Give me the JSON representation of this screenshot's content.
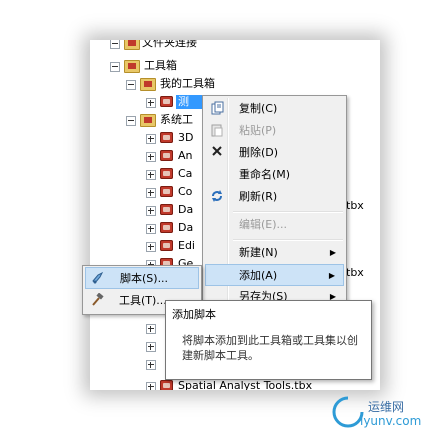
{
  "tree": {
    "top_cut": "文件夹连接",
    "toolbox_root": "工具箱",
    "my_toolbox": "我的工具箱",
    "selected_item": "测",
    "system_toolbox": "系统工",
    "children": [
      "3D",
      "An",
      "Ca",
      "Co",
      "Da",
      "Da",
      "Edi",
      "Ge"
    ],
    "bottom_cut": "Spatial Analyst Tools.tbx",
    "right_fragment_1": "tbx",
    "right_fragment_2": "tbx"
  },
  "context_menu": {
    "items": [
      {
        "label": "复制(C)",
        "icon": "copy-icon",
        "disabled": false
      },
      {
        "label": "粘贴(P)",
        "icon": "paste-icon",
        "disabled": true
      },
      {
        "label": "删除(D)",
        "icon": "delete-icon",
        "disabled": false
      },
      {
        "label": "重命名(M)",
        "icon": "",
        "disabled": false
      },
      {
        "label": "刷新(R)",
        "icon": "refresh-icon",
        "disabled": false
      },
      {
        "label": "编辑(E)...",
        "icon": "",
        "disabled": true
      },
      {
        "label": "新建(N)",
        "icon": "",
        "disabled": false,
        "submenu": true
      },
      {
        "label": "添加(A)",
        "icon": "",
        "disabled": false,
        "submenu": true,
        "highlighted": true
      },
      {
        "label": "另存为(S)",
        "icon": "",
        "disabled": false,
        "submenu": true
      }
    ]
  },
  "submenu": {
    "items": [
      {
        "label": "脚本(S)...",
        "icon": "script-icon"
      },
      {
        "label": "工具(T)...",
        "icon": "hammer-icon"
      }
    ]
  },
  "tooltip": {
    "title": "添加脚本",
    "description": "将脚本添加到此工具箱或工具集以创建新脚本工具。"
  },
  "watermark": {
    "line1": "运维网",
    "line2": "iyunv.com"
  }
}
